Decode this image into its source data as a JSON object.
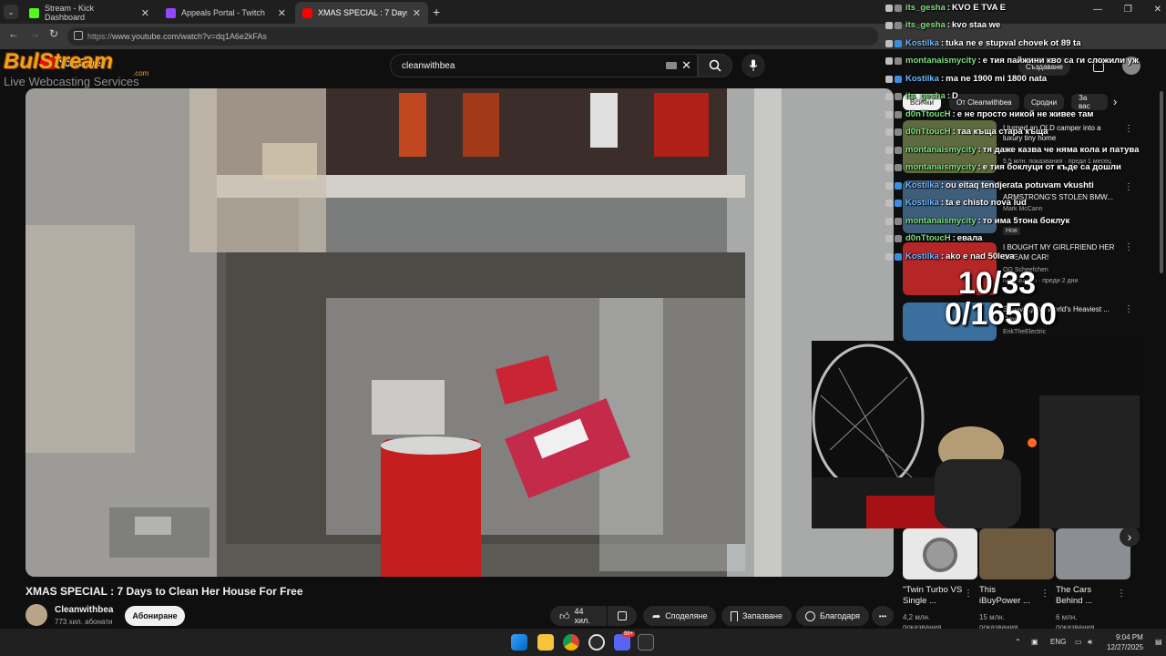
{
  "browser": {
    "tabs": [
      {
        "title": "Stream - Kick Dashboard",
        "color": "#53fc18"
      },
      {
        "title": "Appeals Portal - Twitch",
        "color": "#9146ff"
      },
      {
        "title": "XMAS SPECIAL : 7 Days to Clean",
        "color": "#ff0000"
      }
    ],
    "new_tab": "+",
    "url_prefix": "https://",
    "url": "www.youtube.com/watch?v=dq1A6e2kFAs"
  },
  "overlay_logo": {
    "name": "BulStream",
    "suffix": ".com",
    "tagline": "Live Webcasting Services"
  },
  "youtube": {
    "logo_text": "YouTube",
    "search_value": "cleanwithbea",
    "video_title": "XMAS SPECIAL : 7 Days to Clean Her House For Free",
    "channel_name": "Cleanwithbea",
    "channel_subs": "773 хил. абонати",
    "subscribe_label": "Абониране",
    "likes": "44 хил.",
    "share": "Споделяне",
    "save": "Запазване",
    "thanks": "Благодаря",
    "more": "•••",
    "chips": [
      "Всички",
      "От Cleanwithbea",
      "Сродни",
      "За вас"
    ],
    "header_right": "Създаване",
    "recommended": [
      {
        "title": "I turned an OLD camper into a luxury tiny home",
        "meta": "5,5 млн. показвания · преди 1 месец"
      },
      {
        "title": "ARMSTRONG'S STOLEN BMW...",
        "meta": "Mark McCann",
        "badge": "Нов"
      },
      {
        "title": "I BOUGHT MY GIRLFRIEND HER DREAM CAR!",
        "meta": "OG Scheefchen",
        "meta2": "показвания · преди 2 дни"
      },
      {
        "title": "Surviving the World's Heaviest ... Days",
        "meta": "ErikTheElectric"
      }
    ],
    "shorts": [
      {
        "title": "\"Twin Turbo VS Single ...",
        "meta": "4,2 млн. показвания"
      },
      {
        "title": "This iBuyPower ...",
        "meta": "15 млн. показвания"
      },
      {
        "title": "The Cars Behind ...",
        "meta": "6 млн. показвания"
      }
    ],
    "shorts_arrow": "›"
  },
  "chat": [
    {
      "user": "its_gesha",
      "msg": "KVO E TVA E",
      "color": "#7fe07f"
    },
    {
      "user": "its_gesha",
      "msg": "kvo staa we",
      "color": "#7fe07f"
    },
    {
      "user": "Kostilka",
      "msg": "tuka ne e stupval chovek ot 89 ta",
      "color": "#6fb8ff"
    },
    {
      "user": "montanaismycity",
      "msg": "е тия пайжини кво са ги сложили уж",
      "color": "#7fe07f"
    },
    {
      "user": "Kostilka",
      "msg": "ma ne 1900 mi 1800 nata",
      "color": "#6fb8ff"
    },
    {
      "user": "its_gesha",
      "msg": "D",
      "color": "#7fe07f"
    },
    {
      "user": "d0nTtoucH",
      "msg": "е не просто никой не живее там",
      "color": "#7fe07f"
    },
    {
      "user": "d0nTtoucH",
      "msg": "таа къща стара къща",
      "color": "#7fe07f"
    },
    {
      "user": "montanaismycity",
      "msg": "тя даже казва че няма кола и патува",
      "color": "#7fe07f"
    },
    {
      "user": "montanaismycity",
      "msg": "е тия боклуци от къде са дошли",
      "color": "#7fe07f"
    },
    {
      "user": "Kostilka",
      "msg": "ou eitaq tendjerata potuvam vkushti",
      "color": "#6fb8ff"
    },
    {
      "user": "Kostilka",
      "msg": "ta e chisto nova lud",
      "color": "#6fb8ff"
    },
    {
      "user": "montanaismycity",
      "msg": "то има 5тона боклук",
      "color": "#7fe07f"
    },
    {
      "user": "d0nTtoucH",
      "msg": "евала",
      "color": "#7fe07f"
    },
    {
      "user": "Kostilka",
      "msg": "ako e nad 50leva",
      "color": "#6fb8ff"
    }
  ],
  "counters": {
    "first": "10/33",
    "second": "0/16500"
  },
  "taskbar": {
    "lang": "ENG",
    "time": "9:04 PM",
    "date": "12/27/2025",
    "badge": "99+"
  }
}
